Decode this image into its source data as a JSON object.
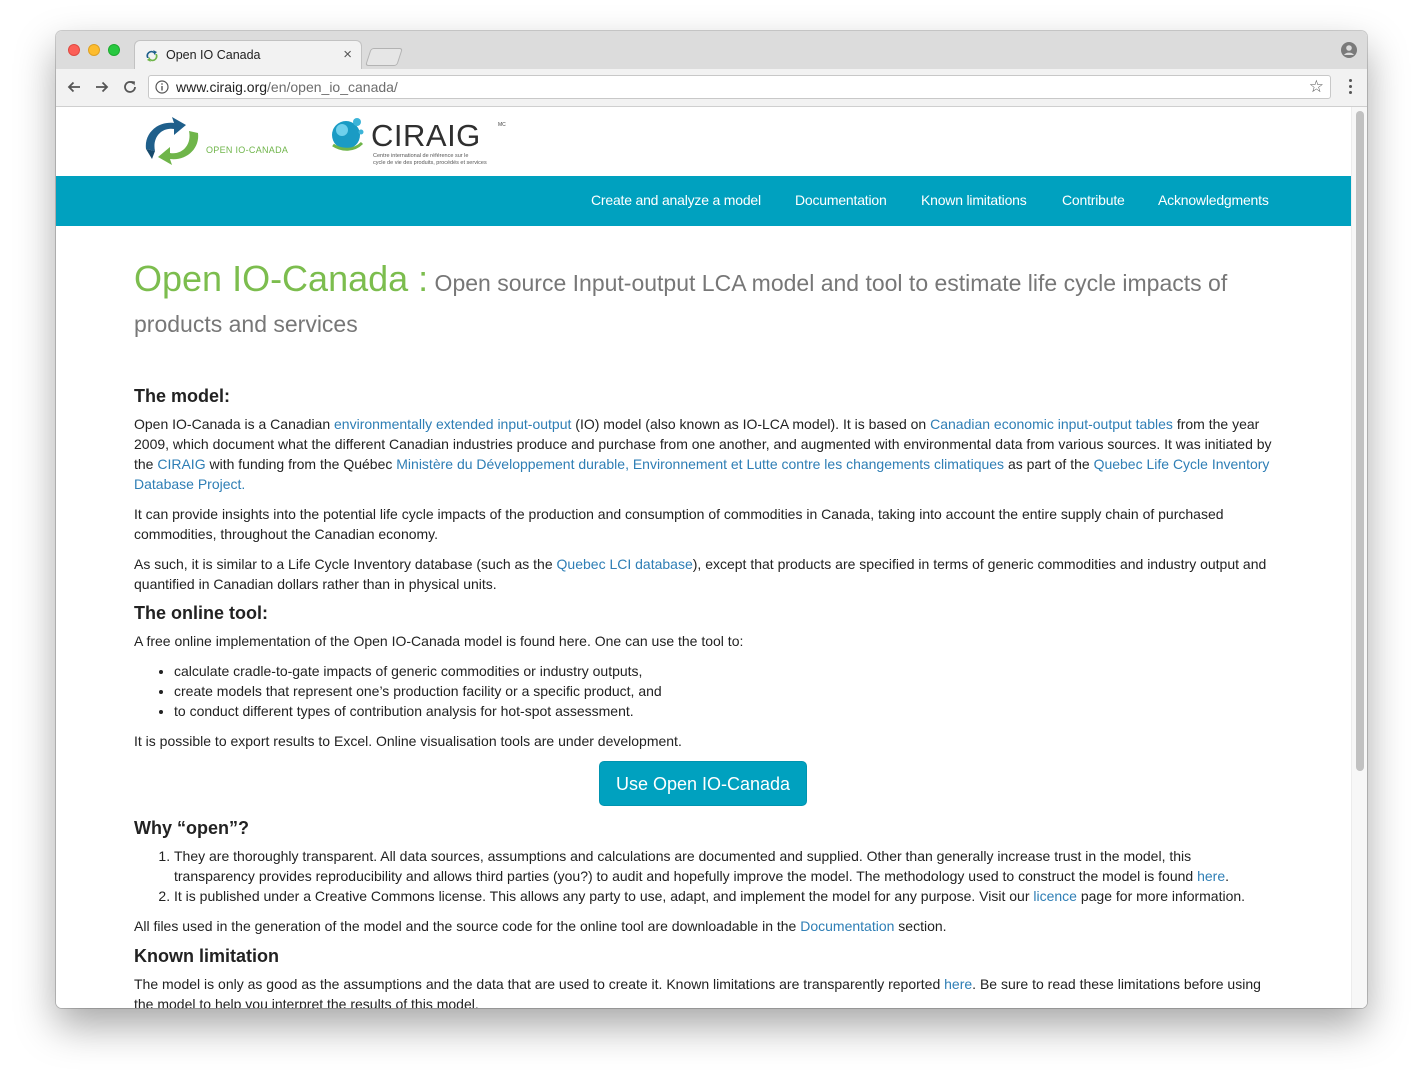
{
  "browser": {
    "tab_title": "Open IO Canada",
    "url_domain": "www.ciraig.org",
    "url_path": "/en/open_io_canada/"
  },
  "logos": {
    "open_io_label": "OPEN IO-CANADA",
    "ciraig_name": "CIRAIG",
    "ciraig_mc": "MC",
    "ciraig_tagline": "Centre international de référence sur le\ncycle de vie des produits, procédés et services"
  },
  "nav": {
    "items": [
      "Create and analyze a model",
      "Documentation",
      "Known limitations",
      "Contribute",
      "Acknowledgments"
    ]
  },
  "page": {
    "title_main": "Open IO-Canada :",
    "title_sub": " Open source Input-output LCA model and tool to estimate life cycle impacts of products and services",
    "model": {
      "heading": "The model:",
      "p1": {
        "t1": "Open IO-Canada is a Canadian ",
        "l1": "environmentally extended input-output",
        "t2": " (IO) model (also known as IO-LCA model). It is based on ",
        "l2": "Canadian economic input-output tables",
        "t3": " from the year 2009, which document what the different Canadian industries produce and purchase from one another, and augmented with environmental data from various sources. It was initiated by the ",
        "l3": "CIRAIG",
        "t4": " with funding from the Québec ",
        "l4": "Ministère du Développement durable, Environnement et Lutte contre les changements climatiques",
        "t5": " as part of the ",
        "l5": "Quebec Life Cycle Inventory Database Project."
      },
      "p2": "It can provide insights into the potential life cycle impacts of the production and consumption of commodities in Canada, taking into account the entire supply chain of purchased commodities, throughout the Canadian economy.",
      "p3": {
        "t1": "As such, it is similar to a Life Cycle Inventory database (such as the ",
        "l1": "Quebec LCI database",
        "t2": "), except that products are specified in terms of generic commodities and industry output and quantified in Canadian dollars rather than in physical units."
      }
    },
    "tool": {
      "heading": "The online tool:",
      "intro": "A free online implementation of the Open IO-Canada model is found here. One can use the tool to:",
      "bullets": [
        "calculate cradle-to-gate impacts of generic commodities or industry outputs,",
        "create models that represent one’s production facility or a specific product, and",
        "to conduct different types of contribution analysis for hot-spot assessment."
      ],
      "export": "It is possible to export results to Excel. Online visualisation tools are under development.",
      "button": "Use Open IO-Canada"
    },
    "open": {
      "heading": "Why “open”?",
      "i1": {
        "text": "They are thoroughly transparent. All data sources, assumptions and calculations are documented and supplied. Other than generally increase trust in the model, this transparency provides reproducibility and allows third parties (you?) to audit and hopefully improve the model. The methodology used to construct the model is found ",
        "link": "here",
        "end": "."
      },
      "i2": {
        "text": "It is published under a Creative Commons license. This allows any party to use, adapt, and implement the model for any purpose. Visit our ",
        "link": "licence",
        "end": " page for more information."
      },
      "files": {
        "text": "All files used in the generation of the model and the source code for the online tool are downloadable in the ",
        "link": "Documentation",
        "end": " section."
      }
    },
    "limitation": {
      "heading": "Known limitation",
      "text": "The model is only as good as the assumptions and the data that are used to create it. Known limitations are transparently reported ",
      "link": "here",
      "end": ". Be sure to read these limitations before using the model to help you interpret the results of this model."
    }
  },
  "colors": {
    "nav_bg": "#00a1bf",
    "title_green": "#7cbd4e",
    "link_blue": "#2e7eb5"
  },
  "icons": [
    "back-arrow-icon",
    "forward-arrow-icon",
    "reload-icon",
    "info-icon",
    "star-icon",
    "menu-dots-icon",
    "profile-icon",
    "favicon-icon",
    "close-icon"
  ]
}
